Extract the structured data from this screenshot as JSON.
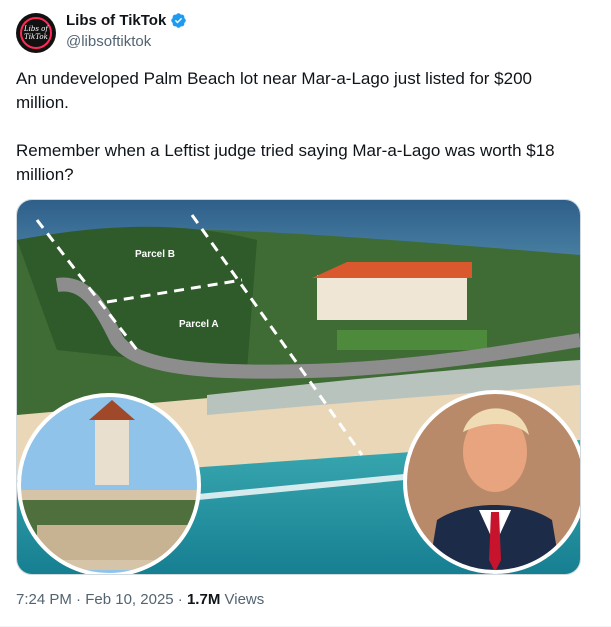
{
  "author": {
    "display_name": "Libs of TikTok",
    "handle": "@libsoftiktok",
    "avatar_text": "Libs of TikTok"
  },
  "tweet": {
    "text": "An undeveloped Palm Beach lot near Mar-a-Lago just listed for $200 million.\n\nRemember when a Leftist judge tried saying Mar-a-Lago was worth $18 million?",
    "time": "7:24 PM",
    "sep1": "·",
    "date": "Feb 10, 2025",
    "sep2": "·",
    "views_count": "1.7M",
    "views_label": "Views"
  },
  "media": {
    "labels": {
      "parcel_b": "Parcel B",
      "parcel_a": "Parcel A"
    }
  },
  "colors": {
    "verified": "#1d9bf0",
    "muted": "#536471",
    "text": "#0f1419"
  },
  "icons": {
    "verified": "verified-badge-icon"
  }
}
